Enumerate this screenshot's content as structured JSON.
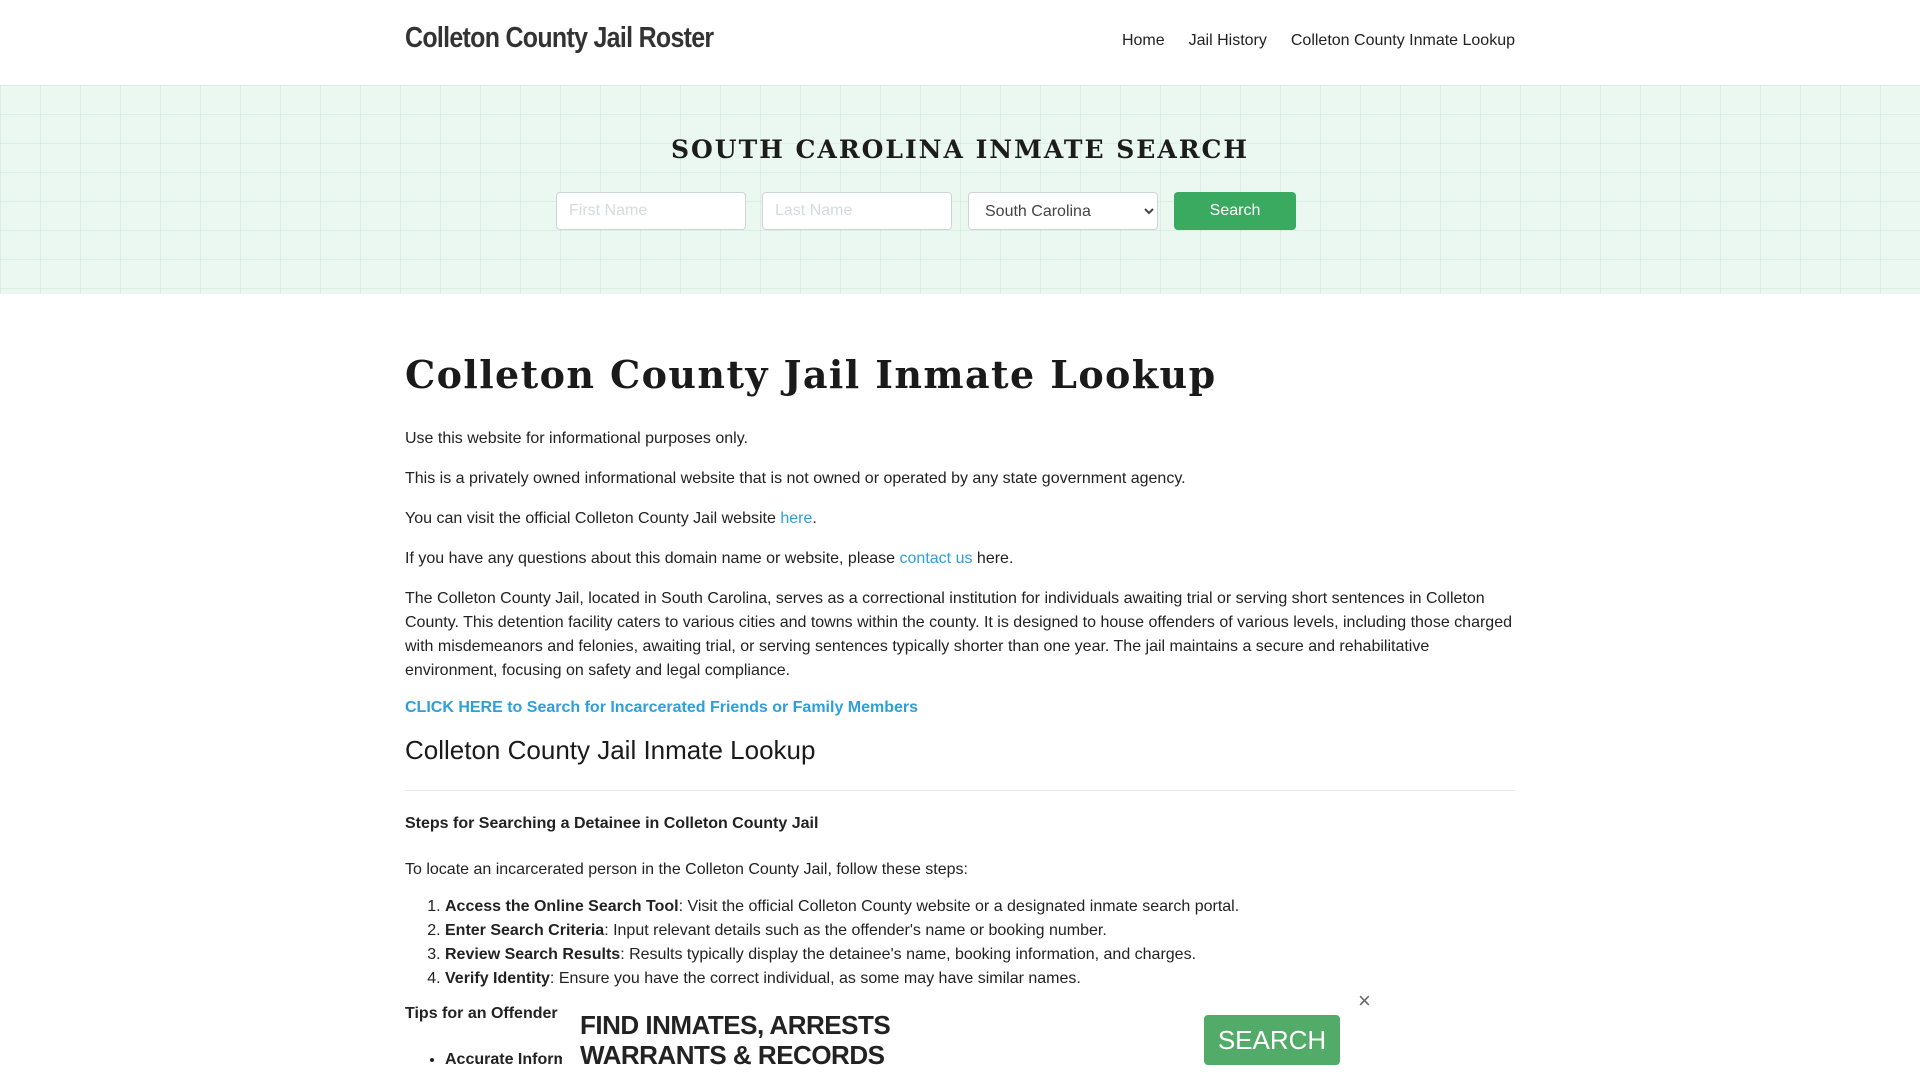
{
  "header": {
    "brand": "Colleton County Jail Roster",
    "nav": [
      "Home",
      "Jail History",
      "Colleton County Inmate Lookup"
    ]
  },
  "hero": {
    "title": "SOUTH CAROLINA INMATE SEARCH",
    "first_name_placeholder": "First Name",
    "last_name_placeholder": "Last Name",
    "state_selected": "South Carolina",
    "search_label": "Search"
  },
  "content": {
    "page_title": "Colleton County Jail Inmate Lookup",
    "p1": "Use this website for informational purposes only.",
    "p2": "This is a privately owned informational website that is not owned or operated by any state government agency.",
    "p3_before": "You can visit the official Colleton County Jail website ",
    "p3_link": "here",
    "p3_after": ".",
    "p4_before": "If you have any questions about this domain name or website, please ",
    "p4_link": "contact us",
    "p4_after": " here.",
    "p5": "The Colleton County Jail, located in South Carolina, serves as a correctional institution for individuals awaiting trial or serving short sentences in Colleton County. This detention facility caters to various cities and towns within the county. It is designed to house offenders of various levels, including those charged with misdemeanors and felonies, awaiting trial, or serving sentences typically shorter than one year. The jail maintains a secure and rehabilitative environment, focusing on safety and legal compliance.",
    "cta": "CLICK HERE to Search for Incarcerated Friends or Family Members",
    "sub_title": "Colleton County Jail Inmate Lookup",
    "steps_head": "Steps for Searching a Detainee in Colleton County Jail",
    "steps_intro": "To locate an incarcerated person in the Colleton County Jail, follow these steps:",
    "steps": [
      {
        "bold": "Access the Online Search Tool",
        "text": ": Visit the official Colleton County website or a designated inmate search portal."
      },
      {
        "bold": "Enter Search Criteria",
        "text": ": Input relevant details such as the offender's name or booking number."
      },
      {
        "bold": "Review Search Results",
        "text": ": Results typically display the detainee's name, booking information, and charges."
      },
      {
        "bold": "Verify Identity",
        "text": ": Ensure you have the correct individual, as some may have similar names."
      }
    ],
    "tips_head": "Tips for an Offender S",
    "tips": [
      {
        "bold": "Accurate Inform"
      }
    ]
  },
  "ad": {
    "line1": "FIND INMATES, ARRESTS",
    "line2": "WARRANTS & RECORDS",
    "button": "SEARCH",
    "close": "×"
  }
}
